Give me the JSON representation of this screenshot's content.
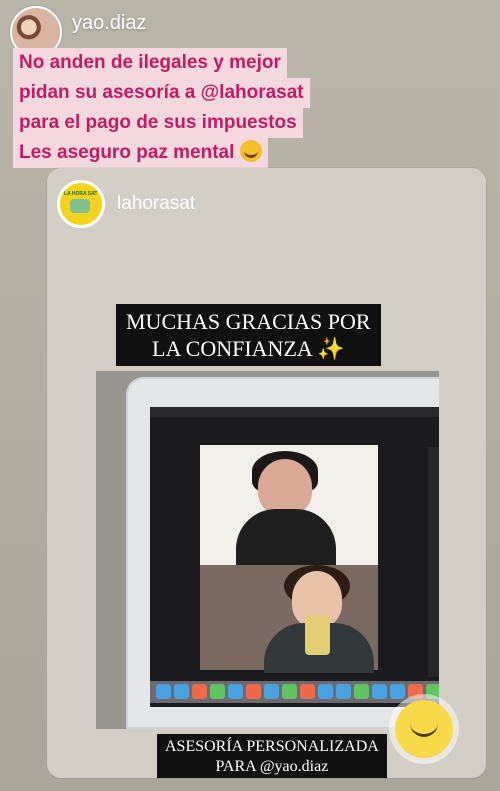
{
  "story": {
    "username": "yao.diaz",
    "caption_lines": [
      "No anden de ilegales y mejor",
      "pidan su asesoría a @lahorasat",
      "para el pago de sus impuestos",
      "Les aseguro paz mental"
    ],
    "emoji": "grinning-face"
  },
  "shared_post": {
    "username": "lahorasat",
    "banner_top": [
      "MUCHAS GRACIAS POR",
      "LA CONFIANZA ✨"
    ],
    "banner_bottom": [
      "ASESORÍA PERSONALIZADA",
      "PARA @yao.diaz"
    ],
    "sticker": "sun-icon"
  }
}
